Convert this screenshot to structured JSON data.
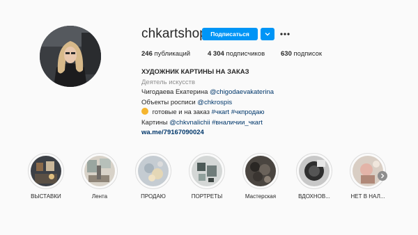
{
  "profile": {
    "username": "chkartshop",
    "follow_label": "Подписаться"
  },
  "stats": {
    "posts": "246",
    "posts_label": "публикаций",
    "followers": "4 304",
    "followers_label": "подписчиков",
    "following": "630",
    "following_label": "подписок"
  },
  "bio": {
    "title": "ХУДОЖНИК КАРТИНЫ НА ЗАКАЗ",
    "category": "Деятель искусств",
    "line1_text": "Чигодаева Екатерина ",
    "line1_mention": "@chigodaevakaterina",
    "line2_text": "Объекты росписи ",
    "line2_mention": "@chkrospis",
    "line3_text": " готовые и на заказ ",
    "line3_tags": "#чкart #чкпродаю",
    "line4_text": "Картины ",
    "line4_mention": "@chkvnalichii",
    "line4_tag": " #вналичии_чкart",
    "website": "wa.me/79167090024"
  },
  "highlights": [
    {
      "label": "ВЫСТАВКИ"
    },
    {
      "label": "Лента"
    },
    {
      "label": "ПРОДАЮ"
    },
    {
      "label": "ПОРТРЕТЫ"
    },
    {
      "label": "Мастерская"
    },
    {
      "label": "ВДОХНОВ..."
    },
    {
      "label": "НЕТ В НАЛ..."
    }
  ],
  "icons": {
    "dropdown": "chevron-down-icon",
    "more": "more-horizontal-icon",
    "next": "chevron-right-icon",
    "emoji": "clay-pot-emoji"
  },
  "colors": {
    "accent": "#0095f6",
    "link": "#00376b",
    "muted": "#8e8e8e"
  }
}
